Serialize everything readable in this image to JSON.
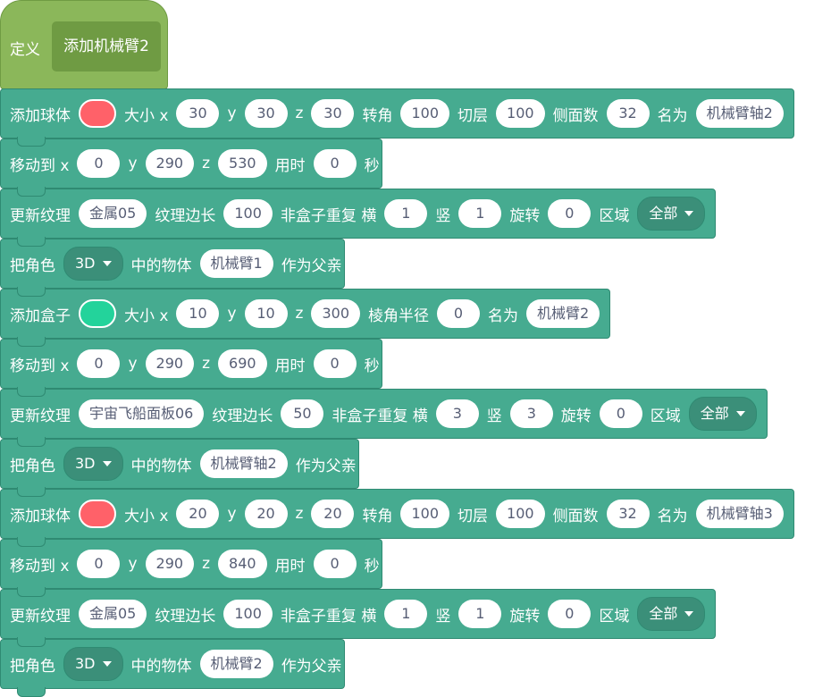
{
  "hat": {
    "label": "定义",
    "proc": "添加机械臂2"
  },
  "colors": {
    "red": "#ff6169",
    "green": "#23d39b"
  },
  "blocks": [
    [
      {
        "t": "text",
        "v": "添加球体"
      },
      {
        "t": "swatch",
        "v": "red"
      },
      {
        "t": "text",
        "v": "大小 x"
      },
      {
        "t": "pill",
        "v": "30"
      },
      {
        "t": "text",
        "v": "y"
      },
      {
        "t": "pill",
        "v": "30"
      },
      {
        "t": "text",
        "v": "z"
      },
      {
        "t": "pill",
        "v": "30"
      },
      {
        "t": "text",
        "v": "转角"
      },
      {
        "t": "pill",
        "v": "100"
      },
      {
        "t": "text",
        "v": "切层"
      },
      {
        "t": "pill",
        "v": "100"
      },
      {
        "t": "text",
        "v": "侧面数"
      },
      {
        "t": "pill",
        "v": "32"
      },
      {
        "t": "text",
        "v": "名为"
      },
      {
        "t": "pill",
        "v": "机械臂轴2"
      }
    ],
    [
      {
        "t": "text",
        "v": "移动到 x"
      },
      {
        "t": "pill",
        "v": "0"
      },
      {
        "t": "text",
        "v": "y"
      },
      {
        "t": "pill",
        "v": "290"
      },
      {
        "t": "text",
        "v": "z"
      },
      {
        "t": "pill",
        "v": "530"
      },
      {
        "t": "text",
        "v": "用时"
      },
      {
        "t": "pill",
        "v": "0"
      },
      {
        "t": "text",
        "v": "秒"
      }
    ],
    [
      {
        "t": "text",
        "v": "更新纹理"
      },
      {
        "t": "pill",
        "v": "金属05"
      },
      {
        "t": "text",
        "v": "纹理边长"
      },
      {
        "t": "pill",
        "v": "100"
      },
      {
        "t": "text",
        "v": "非盒子重复 横"
      },
      {
        "t": "pill",
        "v": "1"
      },
      {
        "t": "text",
        "v": "竖"
      },
      {
        "t": "pill",
        "v": "1"
      },
      {
        "t": "text",
        "v": "旋转"
      },
      {
        "t": "pill",
        "v": "0"
      },
      {
        "t": "text",
        "v": "区域"
      },
      {
        "t": "dropdown",
        "v": "全部"
      }
    ],
    [
      {
        "t": "text",
        "v": "把角色"
      },
      {
        "t": "dropdown",
        "v": "3D"
      },
      {
        "t": "text",
        "v": "中的物体"
      },
      {
        "t": "pill",
        "v": "机械臂1"
      },
      {
        "t": "text",
        "v": "作为父亲"
      }
    ],
    [
      {
        "t": "text",
        "v": "添加盒子"
      },
      {
        "t": "swatch",
        "v": "green"
      },
      {
        "t": "text",
        "v": "大小 x"
      },
      {
        "t": "pill",
        "v": "10"
      },
      {
        "t": "text",
        "v": "y"
      },
      {
        "t": "pill",
        "v": "10"
      },
      {
        "t": "text",
        "v": "z"
      },
      {
        "t": "pill",
        "v": "300"
      },
      {
        "t": "text",
        "v": "棱角半径"
      },
      {
        "t": "pill",
        "v": "0"
      },
      {
        "t": "text",
        "v": "名为"
      },
      {
        "t": "pill",
        "v": "机械臂2"
      }
    ],
    [
      {
        "t": "text",
        "v": "移动到 x"
      },
      {
        "t": "pill",
        "v": "0"
      },
      {
        "t": "text",
        "v": "y"
      },
      {
        "t": "pill",
        "v": "290"
      },
      {
        "t": "text",
        "v": "z"
      },
      {
        "t": "pill",
        "v": "690"
      },
      {
        "t": "text",
        "v": "用时"
      },
      {
        "t": "pill",
        "v": "0"
      },
      {
        "t": "text",
        "v": "秒"
      }
    ],
    [
      {
        "t": "text",
        "v": "更新纹理"
      },
      {
        "t": "pill",
        "v": "宇宙飞船面板06"
      },
      {
        "t": "text",
        "v": "纹理边长"
      },
      {
        "t": "pill",
        "v": "50"
      },
      {
        "t": "text",
        "v": "非盒子重复 横"
      },
      {
        "t": "pill",
        "v": "3"
      },
      {
        "t": "text",
        "v": "竖"
      },
      {
        "t": "pill",
        "v": "3"
      },
      {
        "t": "text",
        "v": "旋转"
      },
      {
        "t": "pill",
        "v": "0"
      },
      {
        "t": "text",
        "v": "区域"
      },
      {
        "t": "dropdown",
        "v": "全部"
      }
    ],
    [
      {
        "t": "text",
        "v": "把角色"
      },
      {
        "t": "dropdown",
        "v": "3D"
      },
      {
        "t": "text",
        "v": "中的物体"
      },
      {
        "t": "pill",
        "v": "机械臂轴2"
      },
      {
        "t": "text",
        "v": "作为父亲"
      }
    ],
    [
      {
        "t": "text",
        "v": "添加球体"
      },
      {
        "t": "swatch",
        "v": "red"
      },
      {
        "t": "text",
        "v": "大小 x"
      },
      {
        "t": "pill",
        "v": "20"
      },
      {
        "t": "text",
        "v": "y"
      },
      {
        "t": "pill",
        "v": "20"
      },
      {
        "t": "text",
        "v": "z"
      },
      {
        "t": "pill",
        "v": "20"
      },
      {
        "t": "text",
        "v": "转角"
      },
      {
        "t": "pill",
        "v": "100"
      },
      {
        "t": "text",
        "v": "切层"
      },
      {
        "t": "pill",
        "v": "100"
      },
      {
        "t": "text",
        "v": "侧面数"
      },
      {
        "t": "pill",
        "v": "32"
      },
      {
        "t": "text",
        "v": "名为"
      },
      {
        "t": "pill",
        "v": "机械臂轴3"
      }
    ],
    [
      {
        "t": "text",
        "v": "移动到 x"
      },
      {
        "t": "pill",
        "v": "0"
      },
      {
        "t": "text",
        "v": "y"
      },
      {
        "t": "pill",
        "v": "290"
      },
      {
        "t": "text",
        "v": "z"
      },
      {
        "t": "pill",
        "v": "840"
      },
      {
        "t": "text",
        "v": "用时"
      },
      {
        "t": "pill",
        "v": "0"
      },
      {
        "t": "text",
        "v": "秒"
      }
    ],
    [
      {
        "t": "text",
        "v": "更新纹理"
      },
      {
        "t": "pill",
        "v": "金属05"
      },
      {
        "t": "text",
        "v": "纹理边长"
      },
      {
        "t": "pill",
        "v": "100"
      },
      {
        "t": "text",
        "v": "非盒子重复 横"
      },
      {
        "t": "pill",
        "v": "1"
      },
      {
        "t": "text",
        "v": "竖"
      },
      {
        "t": "pill",
        "v": "1"
      },
      {
        "t": "text",
        "v": "旋转"
      },
      {
        "t": "pill",
        "v": "0"
      },
      {
        "t": "text",
        "v": "区域"
      },
      {
        "t": "dropdown",
        "v": "全部"
      }
    ],
    [
      {
        "t": "text",
        "v": "把角色"
      },
      {
        "t": "dropdown",
        "v": "3D"
      },
      {
        "t": "text",
        "v": "中的物体"
      },
      {
        "t": "pill",
        "v": "机械臂2"
      },
      {
        "t": "text",
        "v": "作为父亲"
      }
    ]
  ]
}
